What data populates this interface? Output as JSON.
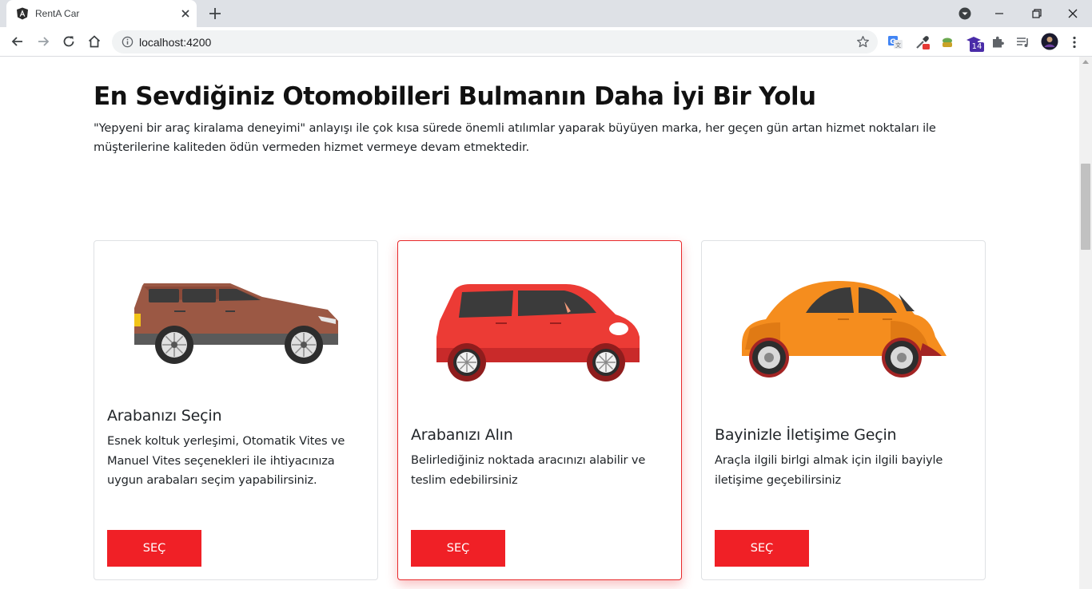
{
  "browser": {
    "tab_title": "RentA Car",
    "url": "localhost:4200",
    "extension_badge_count": "14"
  },
  "page": {
    "headline": "En Sevdiğiniz Otomobilleri Bulmanın Daha İyi Bir Yolu",
    "lead": "\"Yepyeni bir araç kiralama deneyimi\" anlayışı ile çok kısa sürede önemli atılımlar yaparak büyüyen marka, her geçen gün artan hizmet noktaları ile müşterilerine kaliteden ödün vermeden hizmet vermeye devam etmektedir.",
    "cards": [
      {
        "title": "Arabanızı Seçin",
        "text": "Esnek koltuk yerleşimi, Otomatik Vites ve Manuel Vites seçenekleri ile ihtiyacınıza uygun arabaları seçim yapabilirsiniz.",
        "button": "SEÇ",
        "car_color": "#9b5844"
      },
      {
        "title": "Arabanızı Alın",
        "text": "Belirlediğiniz noktada aracınızı alabilir ve teslim edebilirsiniz",
        "button": "SEÇ",
        "car_color": "#ec3b35"
      },
      {
        "title": "Bayinizle İletişime Geçin",
        "text": "Araçla ilgili birlgi almak için ilgili bayiyle iletişime geçebilirsiniz",
        "button": "SEÇ",
        "car_color": "#f58d1e"
      }
    ]
  },
  "colors": {
    "accent_red": "#f02026",
    "active_card_border": "#e8292b"
  }
}
